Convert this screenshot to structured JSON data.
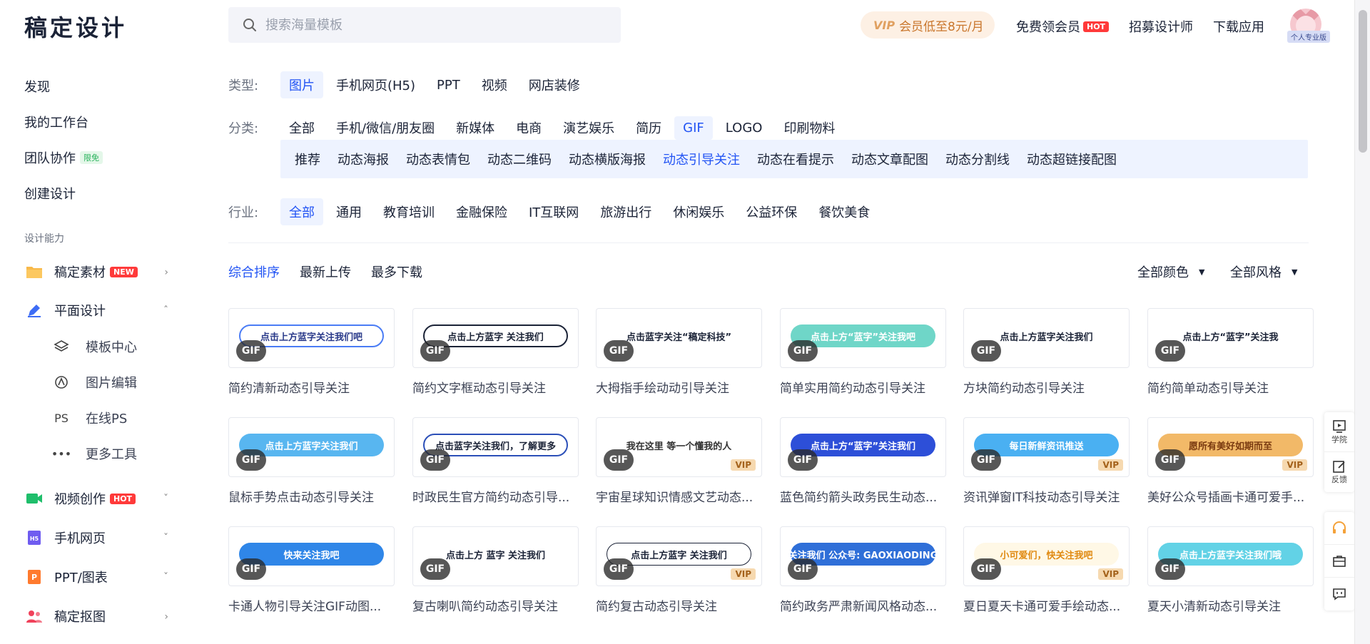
{
  "header": {
    "logo": "稿定设计",
    "search_placeholder": "搜索海量模板",
    "vip_pill": "会员低至8元/月",
    "vip_mark": "VIP",
    "free_vip": "免费领会员",
    "hot_badge": "HOT",
    "recruit": "招募设计师",
    "download": "下载应用",
    "avatar_tag": "个人专业版"
  },
  "sidebar": {
    "items": [
      {
        "label": "发现"
      },
      {
        "label": "我的工作台"
      },
      {
        "label": "团队协作",
        "badge": "限免"
      },
      {
        "label": "创建设计"
      }
    ],
    "section_title": "设计能力",
    "groups": [
      {
        "label": "稿定素材",
        "badge": "NEW"
      },
      {
        "label": "平面设计"
      },
      {
        "label": "视频创作",
        "badge": "HOT"
      },
      {
        "label": "手机网页"
      },
      {
        "label": "PPT/图表"
      },
      {
        "label": "稿定抠图"
      }
    ],
    "sub_items": [
      {
        "label": "模板中心"
      },
      {
        "label": "图片编辑"
      },
      {
        "label": "在线PS",
        "icon_text": "PS"
      },
      {
        "label": "更多工具"
      }
    ]
  },
  "filters": {
    "type_label": "类型:",
    "types": [
      "图片",
      "手机网页(H5)",
      "PPT",
      "视频",
      "网店装修"
    ],
    "category_label": "分类:",
    "categories": [
      "全部",
      "手机/微信/朋友圈",
      "新媒体",
      "电商",
      "演艺娱乐",
      "简历",
      "GIF",
      "LOGO",
      "印刷物料"
    ],
    "subcategories": [
      "推荐",
      "动态海报",
      "动态表情包",
      "动态二维码",
      "动态横版海报",
      "动态引导关注",
      "动态在看提示",
      "动态文章配图",
      "动态分割线",
      "动态超链接配图"
    ],
    "industry_label": "行业:",
    "industries": [
      "全部",
      "通用",
      "教育培训",
      "金融保险",
      "IT互联网",
      "旅游出行",
      "休闲娱乐",
      "公益环保",
      "餐饮美食"
    ]
  },
  "sort": {
    "options": [
      "综合排序",
      "最新上传",
      "最多下载"
    ],
    "color_dropdown": "全部颜色",
    "style_dropdown": "全部风格"
  },
  "cards": [
    {
      "title": "简约清新动态引导关注",
      "banner": "点击上方蓝字关注我们吧",
      "vip": false
    },
    {
      "title": "简约文字框动态引导关注",
      "banner": "点击上方蓝字 关注我们",
      "vip": false
    },
    {
      "title": "大拇指手绘动动引导关注",
      "banner": "点击蓝字关注“稿定科技”",
      "vip": false
    },
    {
      "title": "简单实用简约动态引导关注",
      "banner": "点击上方“蓝字”关注我吧",
      "vip": false
    },
    {
      "title": "方块简约动态引导关注",
      "banner": "点击上方蓝字关注我们",
      "vip": false
    },
    {
      "title": "简约简单动态引导关注",
      "banner": "点击上方“蓝字”关注我",
      "vip": false
    },
    {
      "title": "鼠标手势点击动态引导关注",
      "banner": "点击上方蓝字关注我们",
      "vip": false
    },
    {
      "title": "时政民生官方简约动态引导...",
      "banner": "点击蓝字关注我们，了解更多",
      "vip": false
    },
    {
      "title": "宇宙星球知识情感文艺动态...",
      "banner": "我在这里 等一个懂我的人",
      "vip": true
    },
    {
      "title": "蓝色简约箭头政务民生动态...",
      "banner": "点击上方“蓝字”关注我们",
      "vip": false
    },
    {
      "title": "资讯弹窗IT科技动态引导关注",
      "banner": "每日新鲜资讯推送",
      "vip": true
    },
    {
      "title": "美好公众号插画卡通可爱手...",
      "banner": "愿所有美好如期而至",
      "vip": true
    },
    {
      "title": "卡通人物引导关注GIF动图...",
      "banner": "快来关注我吧",
      "vip": false
    },
    {
      "title": "复古喇叭简约动态引导关注",
      "banner": "点击上方 蓝字 关注我们",
      "vip": false
    },
    {
      "title": "简约复古动态引导关注",
      "banner": "点击上方蓝字 关注我们",
      "vip": true
    },
    {
      "title": "简约政务严肃新闻风格动态...",
      "banner": "关注我们 公众号: GAOXIAODING",
      "vip": false
    },
    {
      "title": "夏日夏天卡通可爱手绘动态...",
      "banner": "小可爱们，快关注我吧",
      "vip": true
    },
    {
      "title": "夏天小清新动态引导关注",
      "banner": "点击上方蓝字关注我们哦",
      "vip": false
    }
  ],
  "gif_label": "GIF",
  "vip_label": "VIP",
  "float_panel": {
    "academy": "学院",
    "feedback": "反馈"
  },
  "colors": {
    "accent": "#2254f4",
    "active_bg": "#eef3ff",
    "hot": "#ff3a3a"
  }
}
